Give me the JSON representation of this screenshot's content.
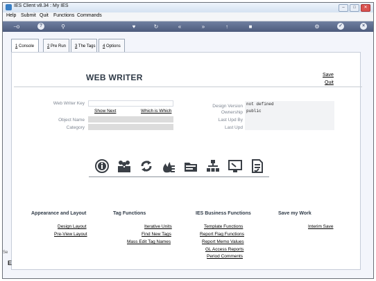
{
  "window": {
    "title": "IES Client v8.34 : My IES"
  },
  "menu": [
    "Help",
    "Submit",
    "Quit",
    "Functions",
    "Commands"
  ],
  "tabs": [
    {
      "num": "1",
      "label": " Console"
    },
    {
      "num": "2",
      "label": " Pre Run"
    },
    {
      "num": "3",
      "label": " The Tags"
    },
    {
      "num": "4",
      "label": " Options"
    }
  ],
  "page": {
    "title": "WEB WRITER",
    "save": "Save",
    "quit": "Quit"
  },
  "form": {
    "web_writer_key_label": "Web Writer Key",
    "show_next": "Show Next",
    "which_is_which": "Which is Which",
    "object_name_label": "Object Name",
    "category_label": "Category",
    "design_version_label": "Design Version",
    "design_version_value": "not defined",
    "ownership_label": "Ownership",
    "ownership_value": "public",
    "last_upd_by_label": "Last Upd By",
    "last_upd_label": "Last Upd"
  },
  "sections": {
    "appearance": {
      "title": "Appearance and Layout",
      "links": [
        "Design Layout",
        "Pre-View Layout"
      ]
    },
    "tag_functions": {
      "title": "Tag Functions",
      "links": [
        "Iterative Units",
        "Find New Tags",
        "Mass Edit Tag Names"
      ]
    },
    "business": {
      "title": "IES Business Functions",
      "links": [
        "Template Functions",
        "Report Flag Functions",
        "Report Memo Values",
        "GL Access Reports",
        "Period Comments"
      ]
    },
    "save": {
      "title": "Save my Work",
      "links": [
        "Interim Save"
      ]
    }
  },
  "sidebar_stub": {
    "top": "Se",
    "bottom": "E"
  },
  "colors": {
    "toolbar": "#56647f",
    "heading": "#2f3a47",
    "field_grey": "#dcdcdc"
  }
}
